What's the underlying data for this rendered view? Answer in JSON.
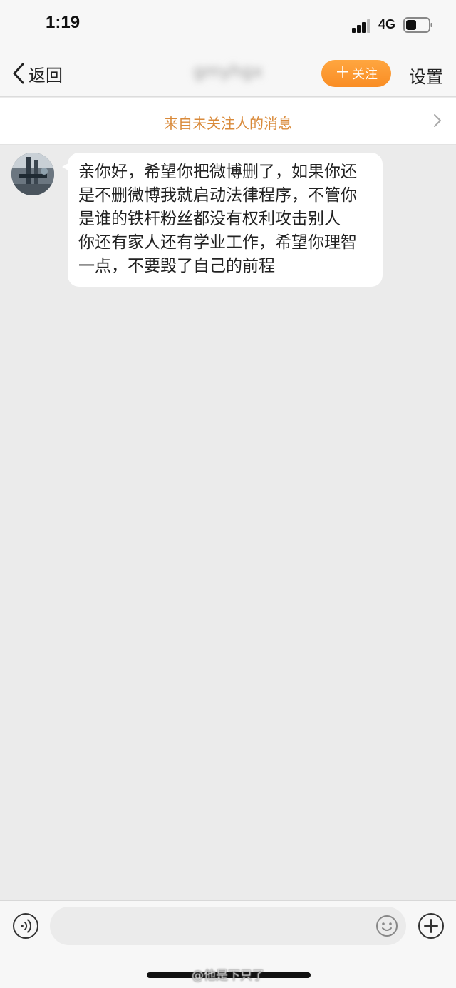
{
  "status_bar": {
    "time": "1:19",
    "network": "4G",
    "icons": [
      "signal-icon",
      "battery-icon"
    ]
  },
  "nav": {
    "back_label": "返回",
    "title": "gmyhgx",
    "follow_label": "关注",
    "follow_icon": "plus-icon",
    "settings_label": "设置",
    "accent_color": "#f98d24"
  },
  "notice": {
    "text": "来自未关注人的消息",
    "icon": "chevron-right-icon",
    "text_color": "#d98a3a"
  },
  "messages": [
    {
      "sender": "other",
      "lines": [
        "亲你好，希望你把微博删了，如果你还是不删微博我就启动法律程序，不管你是谁的铁杆粉丝都没有权利攻击别人",
        "你还有家人还有学业工作，希望你理智一点，不要毁了自己的前程"
      ]
    }
  ],
  "input_bar": {
    "placeholder": "",
    "icons": [
      "voice-icon",
      "emoji-icon",
      "plus-circle-icon"
    ]
  },
  "watermark": "@他是下只了"
}
